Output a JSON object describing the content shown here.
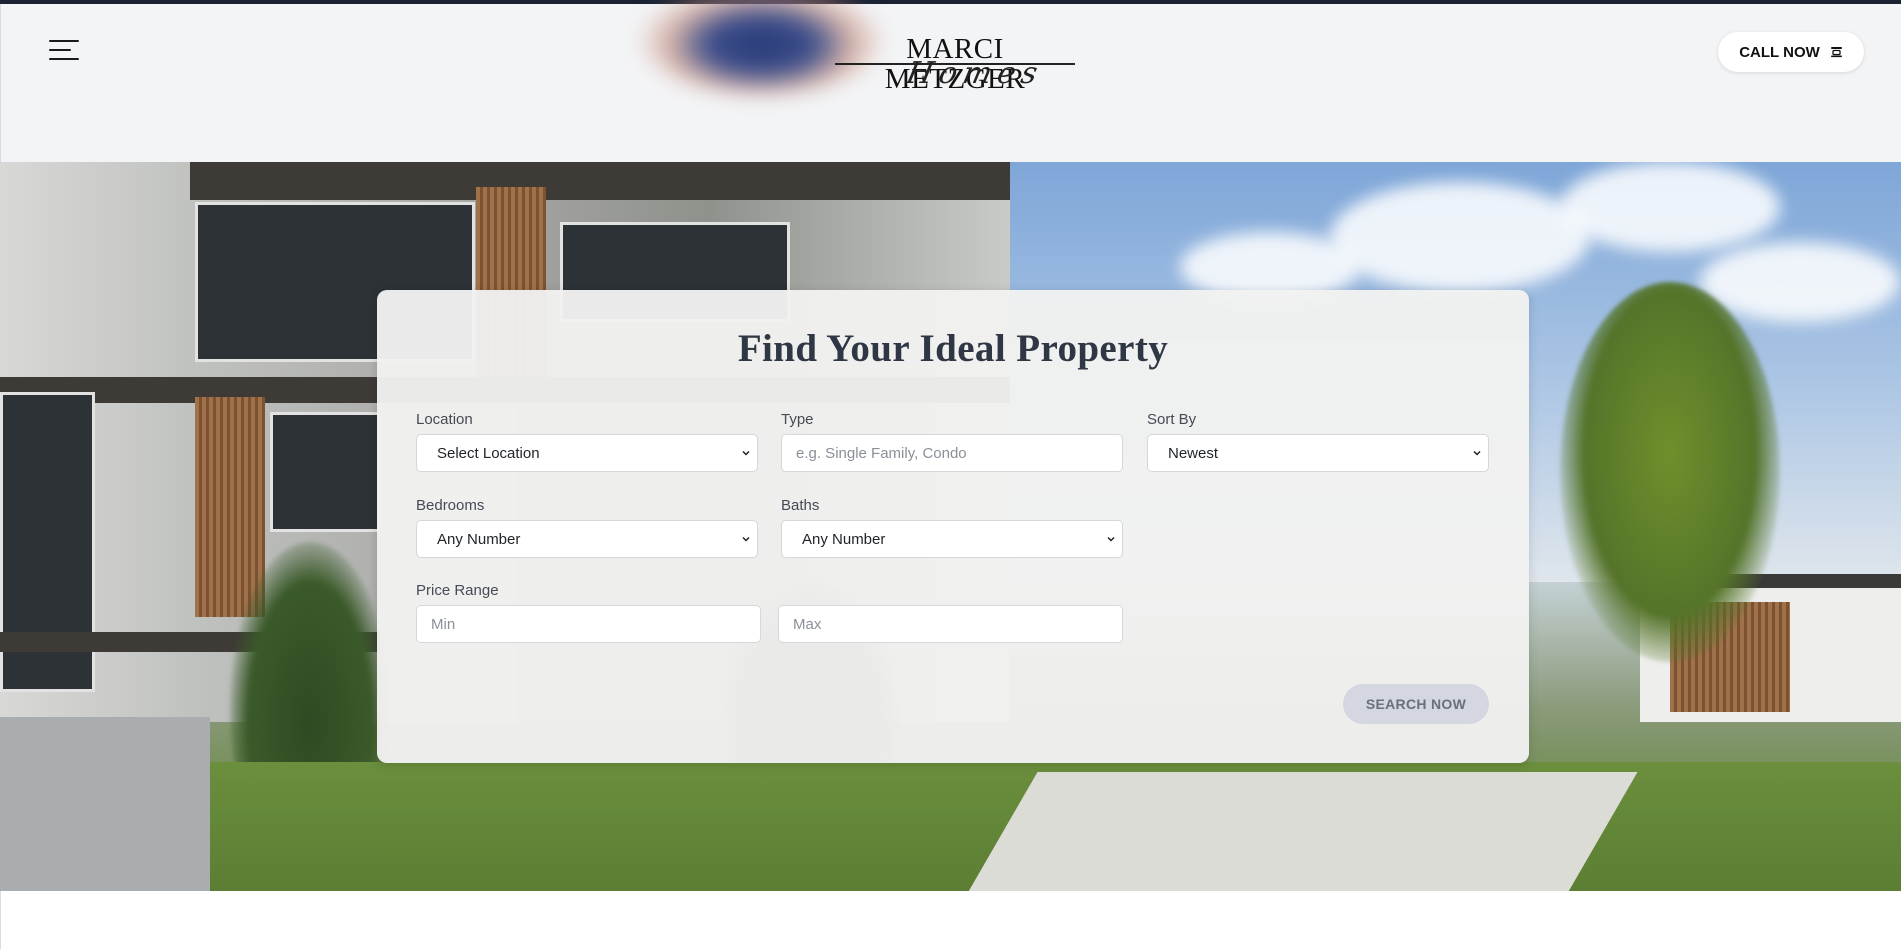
{
  "header": {
    "menu_icon": "hamburger-menu-icon",
    "logo": {
      "main": "MARCI METZGER",
      "script": "Homes"
    },
    "call_button": {
      "label": "CALL NOW",
      "icon": "phone-icon"
    }
  },
  "search": {
    "title": "Find Your Ideal Property",
    "location": {
      "label": "Location",
      "value": "Select Location"
    },
    "type": {
      "label": "Type",
      "placeholder": "e.g. Single Family, Condo"
    },
    "sort_by": {
      "label": "Sort By",
      "value": "Newest"
    },
    "bedrooms": {
      "label": "Bedrooms",
      "value": "Any Number"
    },
    "baths": {
      "label": "Baths",
      "value": "Any Number"
    },
    "price_range": {
      "label": "Price Range",
      "min_placeholder": "Min",
      "max_placeholder": "Max"
    },
    "submit_label": "SEARCH NOW"
  },
  "colors": {
    "header_bg": "#f3f4f6",
    "title_text": "#2f3744",
    "button_disabled_bg": "#d4d7df"
  }
}
